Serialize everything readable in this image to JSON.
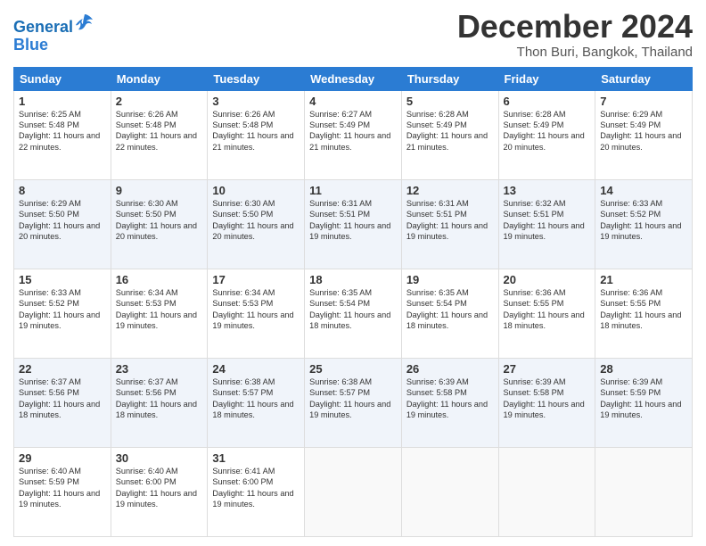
{
  "header": {
    "logo_line1": "General",
    "logo_line2": "Blue",
    "title": "December 2024",
    "subtitle": "Thon Buri, Bangkok, Thailand"
  },
  "weekdays": [
    "Sunday",
    "Monday",
    "Tuesday",
    "Wednesday",
    "Thursday",
    "Friday",
    "Saturday"
  ],
  "weeks": [
    [
      {
        "day": "1",
        "sunrise": "6:25 AM",
        "sunset": "5:48 PM",
        "daylight": "11 hours and 22 minutes."
      },
      {
        "day": "2",
        "sunrise": "6:26 AM",
        "sunset": "5:48 PM",
        "daylight": "11 hours and 22 minutes."
      },
      {
        "day": "3",
        "sunrise": "6:26 AM",
        "sunset": "5:48 PM",
        "daylight": "11 hours and 21 minutes."
      },
      {
        "day": "4",
        "sunrise": "6:27 AM",
        "sunset": "5:49 PM",
        "daylight": "11 hours and 21 minutes."
      },
      {
        "day": "5",
        "sunrise": "6:28 AM",
        "sunset": "5:49 PM",
        "daylight": "11 hours and 21 minutes."
      },
      {
        "day": "6",
        "sunrise": "6:28 AM",
        "sunset": "5:49 PM",
        "daylight": "11 hours and 20 minutes."
      },
      {
        "day": "7",
        "sunrise": "6:29 AM",
        "sunset": "5:49 PM",
        "daylight": "11 hours and 20 minutes."
      }
    ],
    [
      {
        "day": "8",
        "sunrise": "6:29 AM",
        "sunset": "5:50 PM",
        "daylight": "11 hours and 20 minutes."
      },
      {
        "day": "9",
        "sunrise": "6:30 AM",
        "sunset": "5:50 PM",
        "daylight": "11 hours and 20 minutes."
      },
      {
        "day": "10",
        "sunrise": "6:30 AM",
        "sunset": "5:50 PM",
        "daylight": "11 hours and 20 minutes."
      },
      {
        "day": "11",
        "sunrise": "6:31 AM",
        "sunset": "5:51 PM",
        "daylight": "11 hours and 19 minutes."
      },
      {
        "day": "12",
        "sunrise": "6:31 AM",
        "sunset": "5:51 PM",
        "daylight": "11 hours and 19 minutes."
      },
      {
        "day": "13",
        "sunrise": "6:32 AM",
        "sunset": "5:51 PM",
        "daylight": "11 hours and 19 minutes."
      },
      {
        "day": "14",
        "sunrise": "6:33 AM",
        "sunset": "5:52 PM",
        "daylight": "11 hours and 19 minutes."
      }
    ],
    [
      {
        "day": "15",
        "sunrise": "6:33 AM",
        "sunset": "5:52 PM",
        "daylight": "11 hours and 19 minutes."
      },
      {
        "day": "16",
        "sunrise": "6:34 AM",
        "sunset": "5:53 PM",
        "daylight": "11 hours and 19 minutes."
      },
      {
        "day": "17",
        "sunrise": "6:34 AM",
        "sunset": "5:53 PM",
        "daylight": "11 hours and 19 minutes."
      },
      {
        "day": "18",
        "sunrise": "6:35 AM",
        "sunset": "5:54 PM",
        "daylight": "11 hours and 18 minutes."
      },
      {
        "day": "19",
        "sunrise": "6:35 AM",
        "sunset": "5:54 PM",
        "daylight": "11 hours and 18 minutes."
      },
      {
        "day": "20",
        "sunrise": "6:36 AM",
        "sunset": "5:55 PM",
        "daylight": "11 hours and 18 minutes."
      },
      {
        "day": "21",
        "sunrise": "6:36 AM",
        "sunset": "5:55 PM",
        "daylight": "11 hours and 18 minutes."
      }
    ],
    [
      {
        "day": "22",
        "sunrise": "6:37 AM",
        "sunset": "5:56 PM",
        "daylight": "11 hours and 18 minutes."
      },
      {
        "day": "23",
        "sunrise": "6:37 AM",
        "sunset": "5:56 PM",
        "daylight": "11 hours and 18 minutes."
      },
      {
        "day": "24",
        "sunrise": "6:38 AM",
        "sunset": "5:57 PM",
        "daylight": "11 hours and 18 minutes."
      },
      {
        "day": "25",
        "sunrise": "6:38 AM",
        "sunset": "5:57 PM",
        "daylight": "11 hours and 19 minutes."
      },
      {
        "day": "26",
        "sunrise": "6:39 AM",
        "sunset": "5:58 PM",
        "daylight": "11 hours and 19 minutes."
      },
      {
        "day": "27",
        "sunrise": "6:39 AM",
        "sunset": "5:58 PM",
        "daylight": "11 hours and 19 minutes."
      },
      {
        "day": "28",
        "sunrise": "6:39 AM",
        "sunset": "5:59 PM",
        "daylight": "11 hours and 19 minutes."
      }
    ],
    [
      {
        "day": "29",
        "sunrise": "6:40 AM",
        "sunset": "5:59 PM",
        "daylight": "11 hours and 19 minutes."
      },
      {
        "day": "30",
        "sunrise": "6:40 AM",
        "sunset": "6:00 PM",
        "daylight": "11 hours and 19 minutes."
      },
      {
        "day": "31",
        "sunrise": "6:41 AM",
        "sunset": "6:00 PM",
        "daylight": "11 hours and 19 minutes."
      },
      null,
      null,
      null,
      null
    ]
  ]
}
